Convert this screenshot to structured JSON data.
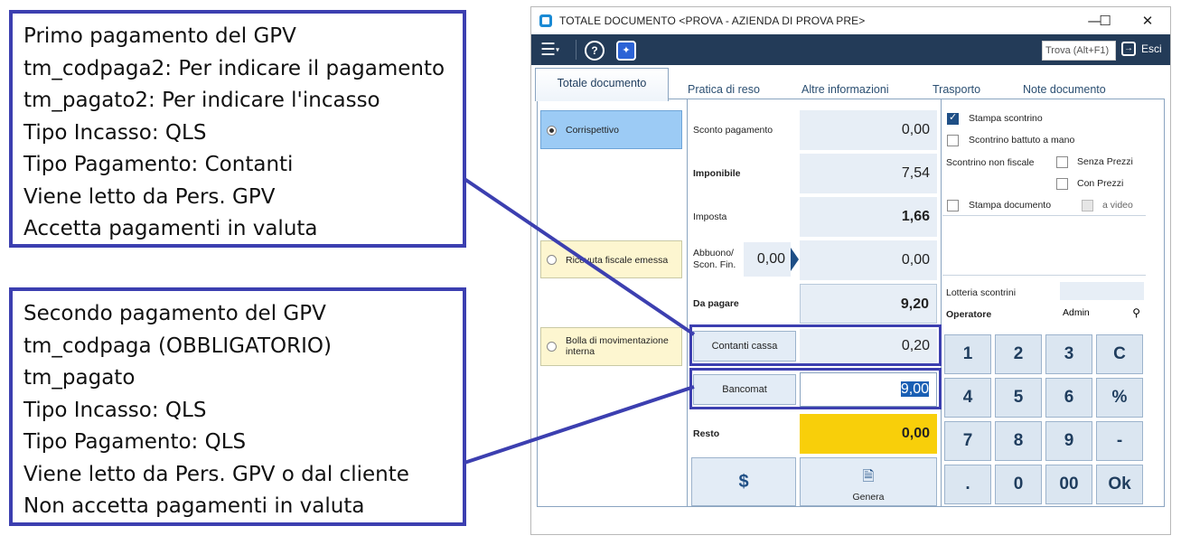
{
  "annotations": {
    "first": [
      "Primo pagamento del GPV",
      "tm_codpaga2: Per indicare il pagamento",
      "tm_pagato2: Per indicare l'incasso",
      "Tipo Incasso: QLS",
      "Tipo Pagamento: Contanti",
      "Viene letto da Pers. GPV",
      "Accetta pagamenti in valuta"
    ],
    "second": [
      "Secondo pagamento del GPV",
      "tm_codpaga (OBBLIGATORIO)",
      "tm_pagato",
      "Tipo Incasso: QLS",
      "Tipo Pagamento: QLS",
      "Viene letto da Pers. GPV o dal cliente",
      "Non accetta pagamenti in valuta"
    ],
    "color": "#3c3fb0"
  },
  "window": {
    "title": "TOTALE DOCUMENTO <PROVA - AZIENDA DI PROVA PRE>",
    "minimize": "—",
    "maximize": "☐",
    "close": "✕"
  },
  "toolbar": {
    "menu_icon": "☰",
    "help_icon": "?",
    "ai_icon": "✦",
    "search_placeholder": "Trova (Alt+F1)",
    "exit_icon": "→",
    "exit_label": "Esci",
    "bg_color": "#233b58"
  },
  "tabs": [
    "Totale documento",
    "Pratica di reso",
    "Altre informazioni",
    "Trasporto",
    "Note documento"
  ],
  "options": [
    {
      "label": "Corrispettivo",
      "selected": true
    },
    {
      "label": "Ricevuta fiscale emessa",
      "selected": false
    },
    {
      "label": "Bolla di movimentazione interna",
      "selected": false
    }
  ],
  "fields": {
    "sconto_label": "Sconto pagamento",
    "sconto_value": "0,00",
    "imponibile_label": "Imponibile",
    "imponibile_value": "7,54",
    "imposta_label": "Imposta",
    "imposta_value": "1,66",
    "abbuono_label": "Abbuono/\nScon. Fin.",
    "abbuono_small_value": "0,00",
    "abbuono_value": "0,00",
    "dapagare_label": "Da pagare",
    "dapagare_value": "9,20",
    "contanti_button": "Contanti cassa",
    "contanti_value": "0,20",
    "bancomat_button": "Bancomat",
    "bancomat_value": "9,00",
    "resto_label": "Resto",
    "resto_value": "0,00",
    "resto_color": "#f8cf0a",
    "dollar_button": "$",
    "genera_icon": "🗎",
    "genera_button": "Genera"
  },
  "right": {
    "stampa_scontrino": "Stampa scontrino",
    "scontrino_mano": "Scontrino battuto a mano",
    "scontrino_non_fiscale": "Scontrino non fiscale",
    "senza_prezzi": "Senza Prezzi",
    "con_prezzi": "Con Prezzi",
    "stampa_documento": "Stampa documento",
    "a_video": "a video",
    "lotteria": "Lotteria scontrini",
    "operatore_label": "Operatore",
    "operatore_value": "Admin",
    "search_icon": "⚲"
  },
  "keypad": [
    "1",
    "2",
    "3",
    "C",
    "4",
    "5",
    "6",
    "%",
    "7",
    "8",
    "9",
    "-",
    ".",
    "0",
    "00",
    "Ok"
  ]
}
